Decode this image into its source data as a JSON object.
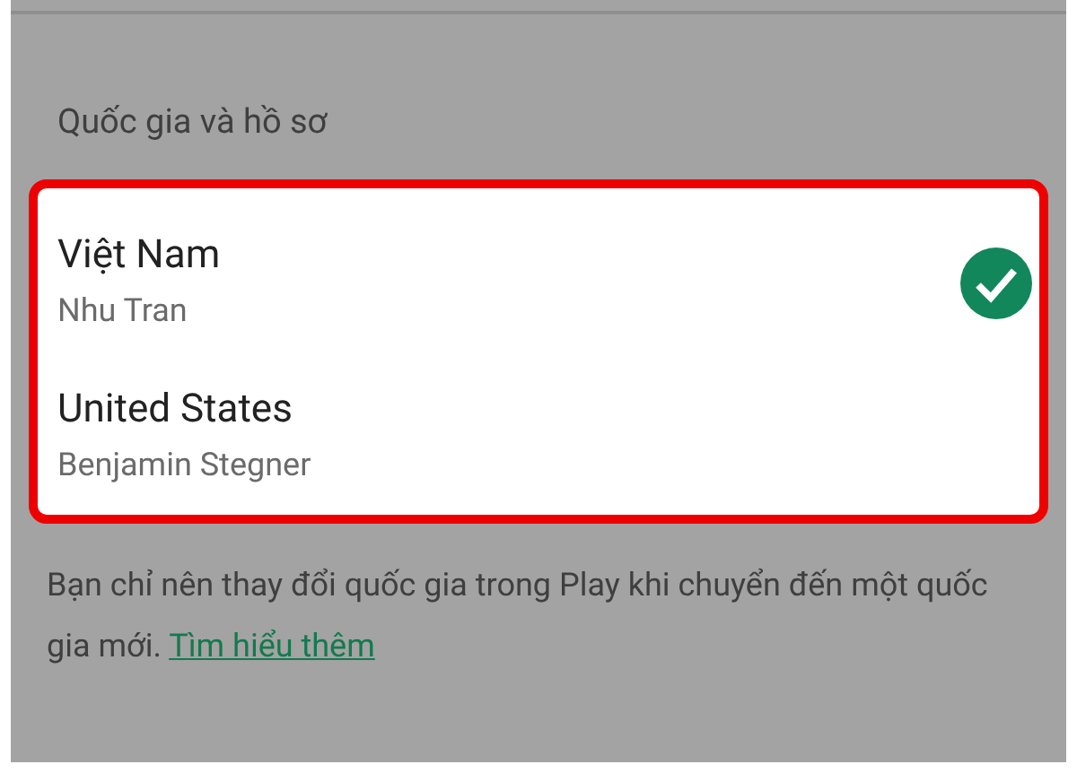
{
  "section_title": "Quốc gia và hồ sơ",
  "countries": [
    {
      "country": "Việt Nam",
      "profile": "Nhu Tran",
      "selected": true
    },
    {
      "country": "United States",
      "profile": "Benjamin Stegner",
      "selected": false
    }
  ],
  "note": {
    "text": "Bạn chỉ nên thay đổi quốc gia trong Play khi chuyển đến một quốc gia mới.",
    "link": "Tìm hiểu thêm"
  }
}
